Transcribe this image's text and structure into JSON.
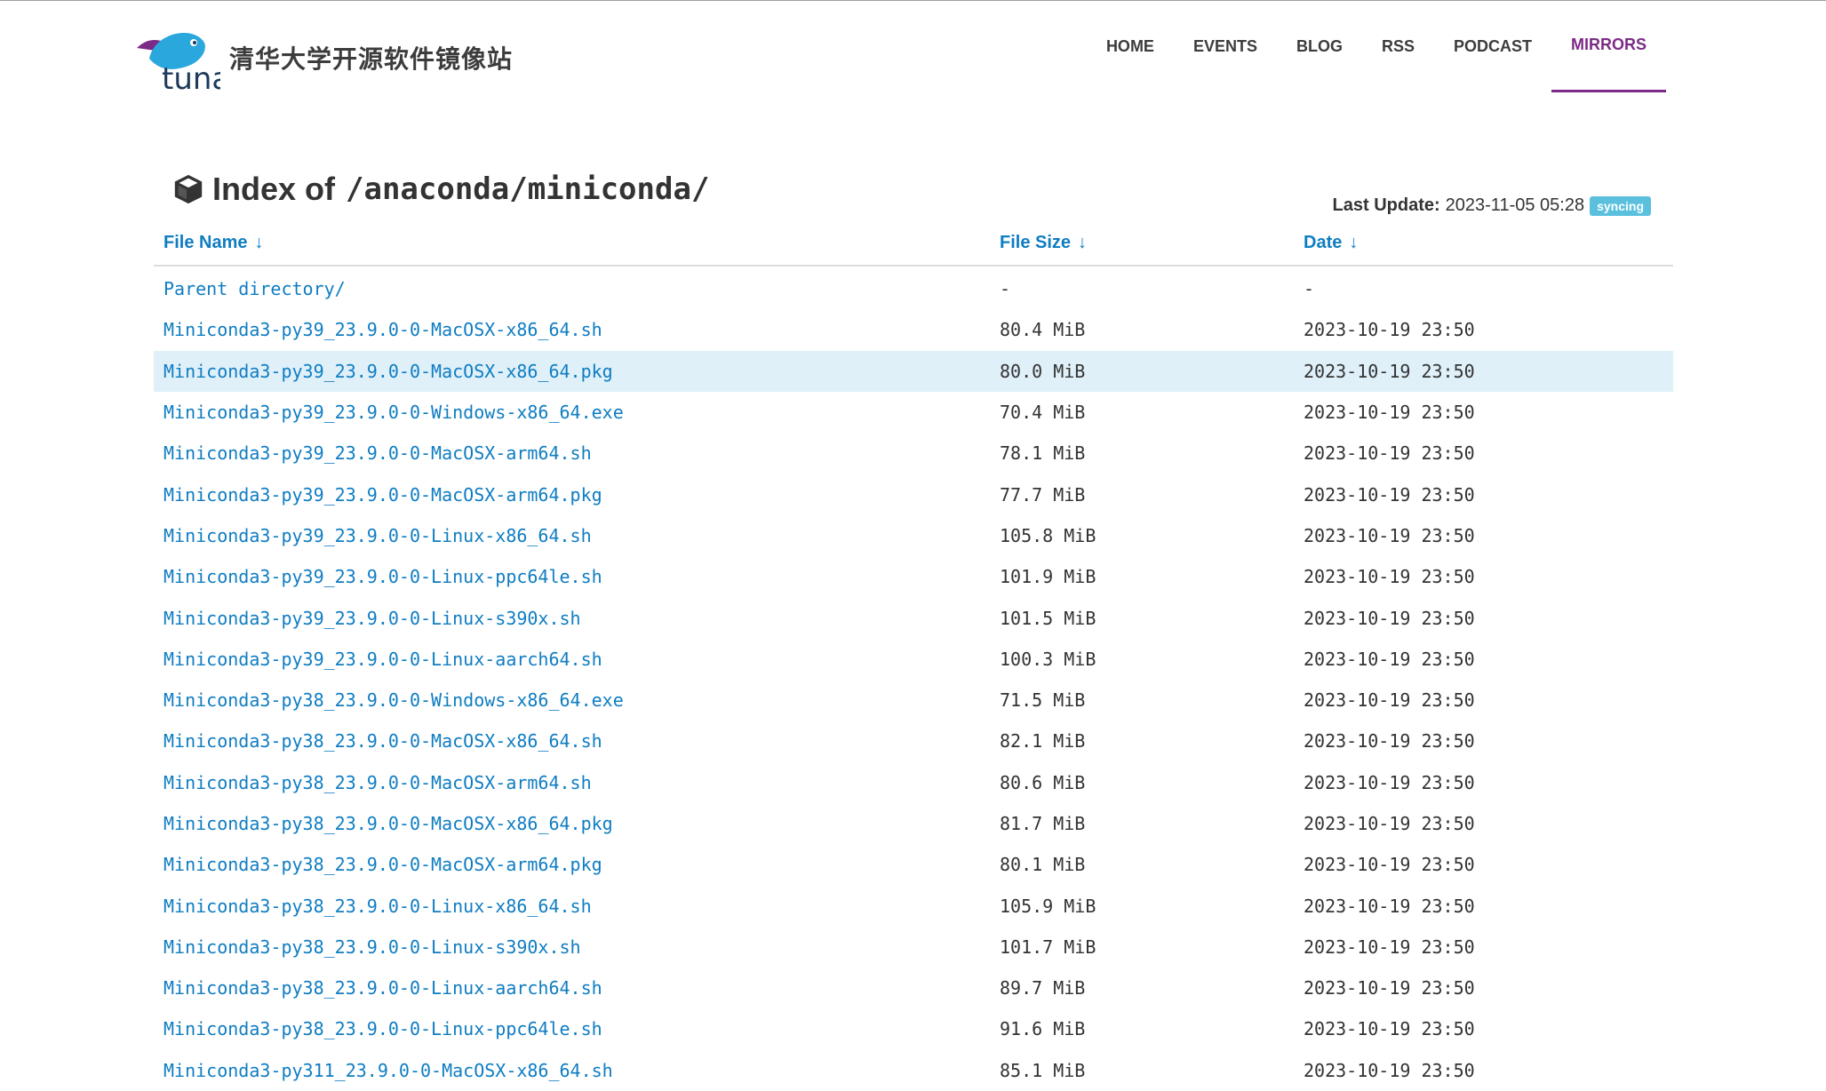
{
  "header": {
    "brand_title": "清华大学开源软件镜像站",
    "logo_text": "tuna",
    "nav": [
      {
        "label": "HOME",
        "active": false
      },
      {
        "label": "EVENTS",
        "active": false
      },
      {
        "label": "BLOG",
        "active": false
      },
      {
        "label": "RSS",
        "active": false
      },
      {
        "label": "PODCAST",
        "active": false
      },
      {
        "label": "MIRRORS",
        "active": true
      }
    ]
  },
  "main": {
    "title_prefix": "Index of",
    "title_path": "/anaconda/miniconda/",
    "last_update_label": "Last Update:",
    "last_update_value": "2023-11-05 05:28",
    "status_badge": "syncing",
    "columns": {
      "name": "File Name",
      "size": "File Size",
      "date": "Date",
      "sort_arrow": "↓"
    },
    "rows": [
      {
        "name": "Parent directory/",
        "size": "-",
        "date": "-"
      },
      {
        "name": "Miniconda3-py39_23.9.0-0-MacOSX-x86_64.sh",
        "size": "80.4 MiB",
        "date": "2023-10-19 23:50"
      },
      {
        "name": "Miniconda3-py39_23.9.0-0-MacOSX-x86_64.pkg",
        "size": "80.0 MiB",
        "date": "2023-10-19 23:50",
        "highlight": true
      },
      {
        "name": "Miniconda3-py39_23.9.0-0-Windows-x86_64.exe",
        "size": "70.4 MiB",
        "date": "2023-10-19 23:50"
      },
      {
        "name": "Miniconda3-py39_23.9.0-0-MacOSX-arm64.sh",
        "size": "78.1 MiB",
        "date": "2023-10-19 23:50"
      },
      {
        "name": "Miniconda3-py39_23.9.0-0-MacOSX-arm64.pkg",
        "size": "77.7 MiB",
        "date": "2023-10-19 23:50"
      },
      {
        "name": "Miniconda3-py39_23.9.0-0-Linux-x86_64.sh",
        "size": "105.8 MiB",
        "date": "2023-10-19 23:50"
      },
      {
        "name": "Miniconda3-py39_23.9.0-0-Linux-ppc64le.sh",
        "size": "101.9 MiB",
        "date": "2023-10-19 23:50"
      },
      {
        "name": "Miniconda3-py39_23.9.0-0-Linux-s390x.sh",
        "size": "101.5 MiB",
        "date": "2023-10-19 23:50"
      },
      {
        "name": "Miniconda3-py39_23.9.0-0-Linux-aarch64.sh",
        "size": "100.3 MiB",
        "date": "2023-10-19 23:50"
      },
      {
        "name": "Miniconda3-py38_23.9.0-0-Windows-x86_64.exe",
        "size": "71.5 MiB",
        "date": "2023-10-19 23:50"
      },
      {
        "name": "Miniconda3-py38_23.9.0-0-MacOSX-x86_64.sh",
        "size": "82.1 MiB",
        "date": "2023-10-19 23:50"
      },
      {
        "name": "Miniconda3-py38_23.9.0-0-MacOSX-arm64.sh",
        "size": "80.6 MiB",
        "date": "2023-10-19 23:50"
      },
      {
        "name": "Miniconda3-py38_23.9.0-0-MacOSX-x86_64.pkg",
        "size": "81.7 MiB",
        "date": "2023-10-19 23:50"
      },
      {
        "name": "Miniconda3-py38_23.9.0-0-MacOSX-arm64.pkg",
        "size": "80.1 MiB",
        "date": "2023-10-19 23:50"
      },
      {
        "name": "Miniconda3-py38_23.9.0-0-Linux-x86_64.sh",
        "size": "105.9 MiB",
        "date": "2023-10-19 23:50"
      },
      {
        "name": "Miniconda3-py38_23.9.0-0-Linux-s390x.sh",
        "size": "101.7 MiB",
        "date": "2023-10-19 23:50"
      },
      {
        "name": "Miniconda3-py38_23.9.0-0-Linux-aarch64.sh",
        "size": "89.7 MiB",
        "date": "2023-10-19 23:50"
      },
      {
        "name": "Miniconda3-py38_23.9.0-0-Linux-ppc64le.sh",
        "size": "91.6 MiB",
        "date": "2023-10-19 23:50"
      },
      {
        "name": "Miniconda3-py311_23.9.0-0-MacOSX-x86_64.sh",
        "size": "85.1 MiB",
        "date": "2023-10-19 23:50"
      }
    ]
  },
  "colors": {
    "link": "#0f7dc2",
    "nav_active": "#7b2b86",
    "badge": "#5bc0de",
    "row_highlight": "#dff0f9",
    "logo_fish": "#2aa7dc",
    "logo_fin": "#7b2b86"
  }
}
